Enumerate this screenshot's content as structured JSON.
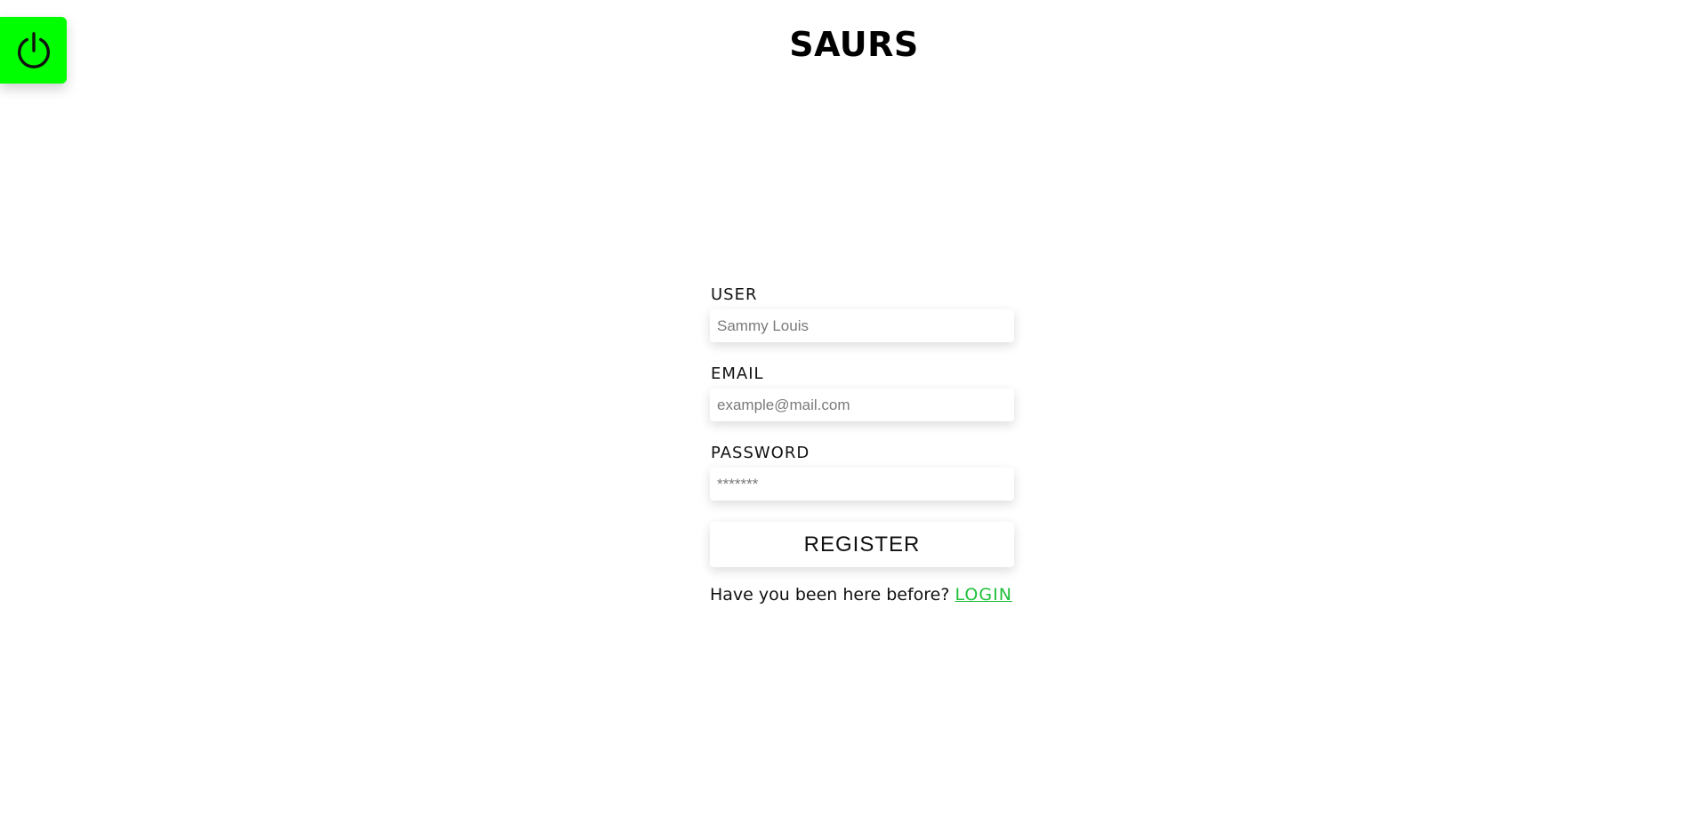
{
  "header": {
    "brand": "SAURS",
    "power_icon": "power-icon",
    "accent_color": "#00ff00"
  },
  "form": {
    "user": {
      "label": "USER",
      "placeholder": "Sammy Louis",
      "value": ""
    },
    "email": {
      "label": "EMAIL",
      "placeholder": "example@mail.com",
      "value": ""
    },
    "password": {
      "label": "PASSWORD",
      "placeholder": "*******",
      "value": ""
    },
    "submit_label": "REGISTER"
  },
  "footer": {
    "prompt": "Have you been here before?",
    "login_label": "LOGIN",
    "link_color": "#1fbf3a"
  }
}
